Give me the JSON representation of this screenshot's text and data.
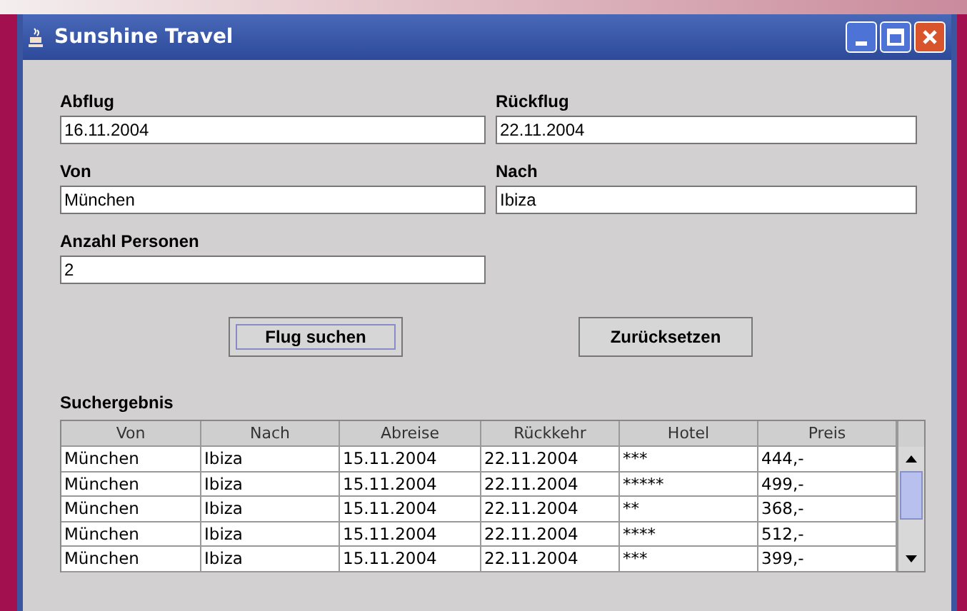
{
  "window": {
    "title": "Sunshine Travel"
  },
  "fields": [
    {
      "label": "Abflug",
      "value": "16.11.2004"
    },
    {
      "label": "Rückflug",
      "value": "22.11.2004"
    },
    {
      "label": "Von",
      "value": "München"
    },
    {
      "label": "Nach",
      "value": "Ibiza"
    },
    {
      "label": "Anzahl Personen",
      "value": "2"
    }
  ],
  "buttons": [
    {
      "label": "Flug suchen",
      "focused": true
    },
    {
      "label": "Zurücksetzen",
      "focused": false
    }
  ],
  "results": {
    "title": "Suchergebnis",
    "columns": [
      "Von",
      "Nach",
      "Abreise",
      "Rückkehr",
      "Hotel",
      "Preis"
    ],
    "rows": [
      [
        "München",
        "Ibiza",
        "15.11.2004",
        "22.11.2004",
        "***",
        "444,-"
      ],
      [
        "München",
        "Ibiza",
        "15.11.2004",
        "22.11.2004",
        "*****",
        "499,-"
      ],
      [
        "München",
        "Ibiza",
        "15.11.2004",
        "22.11.2004",
        "**",
        "368,-"
      ],
      [
        "München",
        "Ibiza",
        "15.11.2004",
        "22.11.2004",
        "****",
        "512,-"
      ],
      [
        "München",
        "Ibiza",
        "15.11.2004",
        "22.11.2004",
        "***",
        "399,-"
      ]
    ]
  }
}
